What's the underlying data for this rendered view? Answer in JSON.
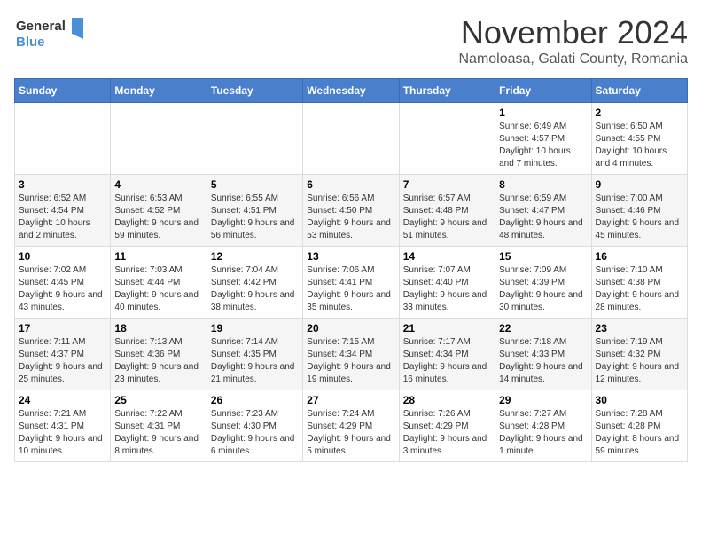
{
  "logo": {
    "line1": "General",
    "line2": "Blue"
  },
  "title": "November 2024",
  "location": "Namoloasa, Galati County, Romania",
  "days_of_week": [
    "Sunday",
    "Monday",
    "Tuesday",
    "Wednesday",
    "Thursday",
    "Friday",
    "Saturday"
  ],
  "weeks": [
    [
      {
        "day": "",
        "info": ""
      },
      {
        "day": "",
        "info": ""
      },
      {
        "day": "",
        "info": ""
      },
      {
        "day": "",
        "info": ""
      },
      {
        "day": "",
        "info": ""
      },
      {
        "day": "1",
        "info": "Sunrise: 6:49 AM\nSunset: 4:57 PM\nDaylight: 10 hours and 7 minutes."
      },
      {
        "day": "2",
        "info": "Sunrise: 6:50 AM\nSunset: 4:55 PM\nDaylight: 10 hours and 4 minutes."
      }
    ],
    [
      {
        "day": "3",
        "info": "Sunrise: 6:52 AM\nSunset: 4:54 PM\nDaylight: 10 hours and 2 minutes."
      },
      {
        "day": "4",
        "info": "Sunrise: 6:53 AM\nSunset: 4:52 PM\nDaylight: 9 hours and 59 minutes."
      },
      {
        "day": "5",
        "info": "Sunrise: 6:55 AM\nSunset: 4:51 PM\nDaylight: 9 hours and 56 minutes."
      },
      {
        "day": "6",
        "info": "Sunrise: 6:56 AM\nSunset: 4:50 PM\nDaylight: 9 hours and 53 minutes."
      },
      {
        "day": "7",
        "info": "Sunrise: 6:57 AM\nSunset: 4:48 PM\nDaylight: 9 hours and 51 minutes."
      },
      {
        "day": "8",
        "info": "Sunrise: 6:59 AM\nSunset: 4:47 PM\nDaylight: 9 hours and 48 minutes."
      },
      {
        "day": "9",
        "info": "Sunrise: 7:00 AM\nSunset: 4:46 PM\nDaylight: 9 hours and 45 minutes."
      }
    ],
    [
      {
        "day": "10",
        "info": "Sunrise: 7:02 AM\nSunset: 4:45 PM\nDaylight: 9 hours and 43 minutes."
      },
      {
        "day": "11",
        "info": "Sunrise: 7:03 AM\nSunset: 4:44 PM\nDaylight: 9 hours and 40 minutes."
      },
      {
        "day": "12",
        "info": "Sunrise: 7:04 AM\nSunset: 4:42 PM\nDaylight: 9 hours and 38 minutes."
      },
      {
        "day": "13",
        "info": "Sunrise: 7:06 AM\nSunset: 4:41 PM\nDaylight: 9 hours and 35 minutes."
      },
      {
        "day": "14",
        "info": "Sunrise: 7:07 AM\nSunset: 4:40 PM\nDaylight: 9 hours and 33 minutes."
      },
      {
        "day": "15",
        "info": "Sunrise: 7:09 AM\nSunset: 4:39 PM\nDaylight: 9 hours and 30 minutes."
      },
      {
        "day": "16",
        "info": "Sunrise: 7:10 AM\nSunset: 4:38 PM\nDaylight: 9 hours and 28 minutes."
      }
    ],
    [
      {
        "day": "17",
        "info": "Sunrise: 7:11 AM\nSunset: 4:37 PM\nDaylight: 9 hours and 25 minutes."
      },
      {
        "day": "18",
        "info": "Sunrise: 7:13 AM\nSunset: 4:36 PM\nDaylight: 9 hours and 23 minutes."
      },
      {
        "day": "19",
        "info": "Sunrise: 7:14 AM\nSunset: 4:35 PM\nDaylight: 9 hours and 21 minutes."
      },
      {
        "day": "20",
        "info": "Sunrise: 7:15 AM\nSunset: 4:34 PM\nDaylight: 9 hours and 19 minutes."
      },
      {
        "day": "21",
        "info": "Sunrise: 7:17 AM\nSunset: 4:34 PM\nDaylight: 9 hours and 16 minutes."
      },
      {
        "day": "22",
        "info": "Sunrise: 7:18 AM\nSunset: 4:33 PM\nDaylight: 9 hours and 14 minutes."
      },
      {
        "day": "23",
        "info": "Sunrise: 7:19 AM\nSunset: 4:32 PM\nDaylight: 9 hours and 12 minutes."
      }
    ],
    [
      {
        "day": "24",
        "info": "Sunrise: 7:21 AM\nSunset: 4:31 PM\nDaylight: 9 hours and 10 minutes."
      },
      {
        "day": "25",
        "info": "Sunrise: 7:22 AM\nSunset: 4:31 PM\nDaylight: 9 hours and 8 minutes."
      },
      {
        "day": "26",
        "info": "Sunrise: 7:23 AM\nSunset: 4:30 PM\nDaylight: 9 hours and 6 minutes."
      },
      {
        "day": "27",
        "info": "Sunrise: 7:24 AM\nSunset: 4:29 PM\nDaylight: 9 hours and 5 minutes."
      },
      {
        "day": "28",
        "info": "Sunrise: 7:26 AM\nSunset: 4:29 PM\nDaylight: 9 hours and 3 minutes."
      },
      {
        "day": "29",
        "info": "Sunrise: 7:27 AM\nSunset: 4:28 PM\nDaylight: 9 hours and 1 minute."
      },
      {
        "day": "30",
        "info": "Sunrise: 7:28 AM\nSunset: 4:28 PM\nDaylight: 8 hours and 59 minutes."
      }
    ]
  ]
}
